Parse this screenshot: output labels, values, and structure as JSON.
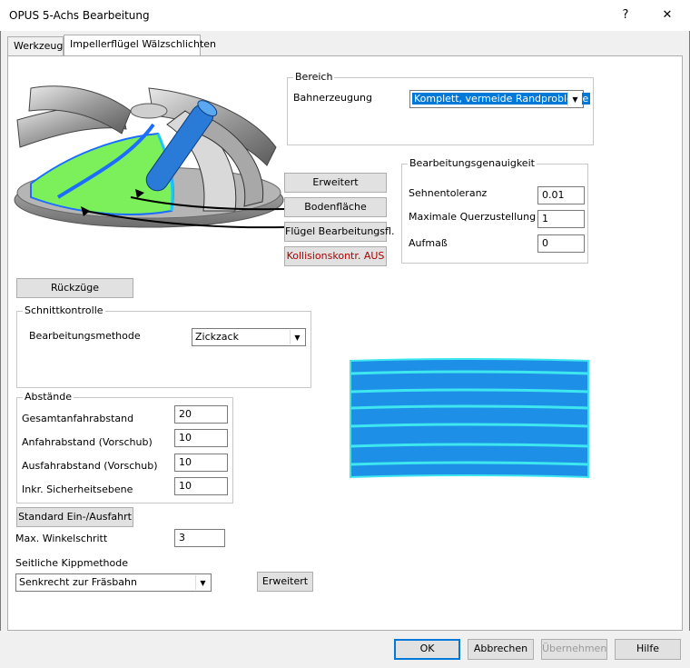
{
  "window": {
    "title": "OPUS 5-Achs Bearbeitung",
    "help_glyph": "?",
    "close_glyph": "✕"
  },
  "tabs": [
    {
      "label": "Werkzeug",
      "active": false
    },
    {
      "label": "Impellerflügel Wälzschlichten",
      "active": true
    }
  ],
  "bereich": {
    "legend": "Bereich",
    "bahnerzeugung_label": "Bahnerzeugung",
    "bahnerzeugung_value": "Komplett, vermeide Randprobleme"
  },
  "genauigkeit": {
    "legend": "Bearbeitungsgenauigkeit",
    "sehnentoleranz_label": "Sehnentoleranz",
    "sehnentoleranz_value": "0.01",
    "querzustellung_label": "Maximale Querzustellung",
    "querzustellung_value": "1",
    "aufmass_label": "Aufmaß",
    "aufmass_value": "0"
  },
  "surface_buttons": {
    "erweitert": "Erweitert",
    "bodenflaeche": "Bodenfläche",
    "fluegel": "Flügel Bearbeitungsfl.",
    "kollision": "Kollisionskontr. AUS"
  },
  "rueckzuege_label": "Rückzüge",
  "schnittkontrolle": {
    "legend": "Schnittkontrolle",
    "methode_label": "Bearbeitungsmethode",
    "methode_value": "Zickzack"
  },
  "abstaende": {
    "legend": "Abstände",
    "rows": [
      {
        "label": "Gesamtanfahrabstand",
        "value": "20"
      },
      {
        "label": "Anfahrabstand (Vorschub)",
        "value": "10"
      },
      {
        "label": "Ausfahrabstand (Vorschub)",
        "value": "10"
      },
      {
        "label": "Inkr. Sicherheitsebene",
        "value": "10"
      }
    ]
  },
  "standard_button": "Standard Ein-/Ausfahrt",
  "winkelschritt": {
    "label": "Max. Winkelschritt",
    "value": "3"
  },
  "kippmethode": {
    "label": "Seitliche Kippmethode",
    "value": "Senkrecht zur Fräsbahn",
    "erweitert": "Erweitert"
  },
  "footer": {
    "ok": "OK",
    "cancel": "Abbrechen",
    "apply": "Übernehmen",
    "help": "Hilfe"
  },
  "colors": {
    "accent": "#0078d7",
    "preview_blue": "#1e8fe6",
    "preview_cyan": "#3ee6f0",
    "impeller_green": "#7cf05a",
    "kollision_red": "#b00000"
  }
}
